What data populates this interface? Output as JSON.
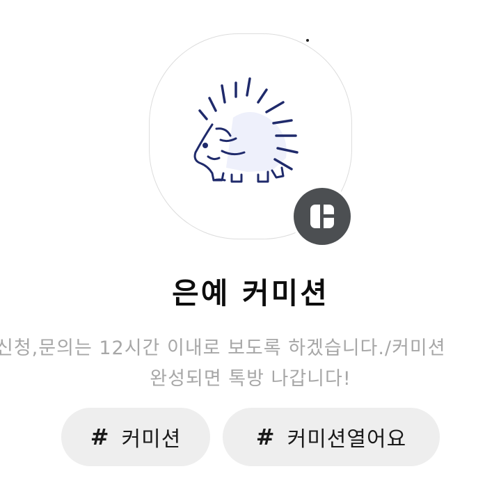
{
  "profile": {
    "image": "hedgehog-drawing",
    "badge_icon": "kakao-channel-icon",
    "name": "은예 커미션",
    "description_line1": "신청,문의는 12시간 이내로 보도록 하겠습니다./커미션",
    "description_line2": "완성되면 톡방 나갑니다!"
  },
  "tags": [
    {
      "hash": "#",
      "label": "커미션"
    },
    {
      "hash": "#",
      "label": "커미션열어요"
    }
  ],
  "colors": {
    "badge": "#4c4f52",
    "tag_background": "#eeeeee",
    "description": "#a7a7a7",
    "hedgehog_line": "#1f2a6b",
    "hedgehog_fill": "#eef0fb"
  }
}
